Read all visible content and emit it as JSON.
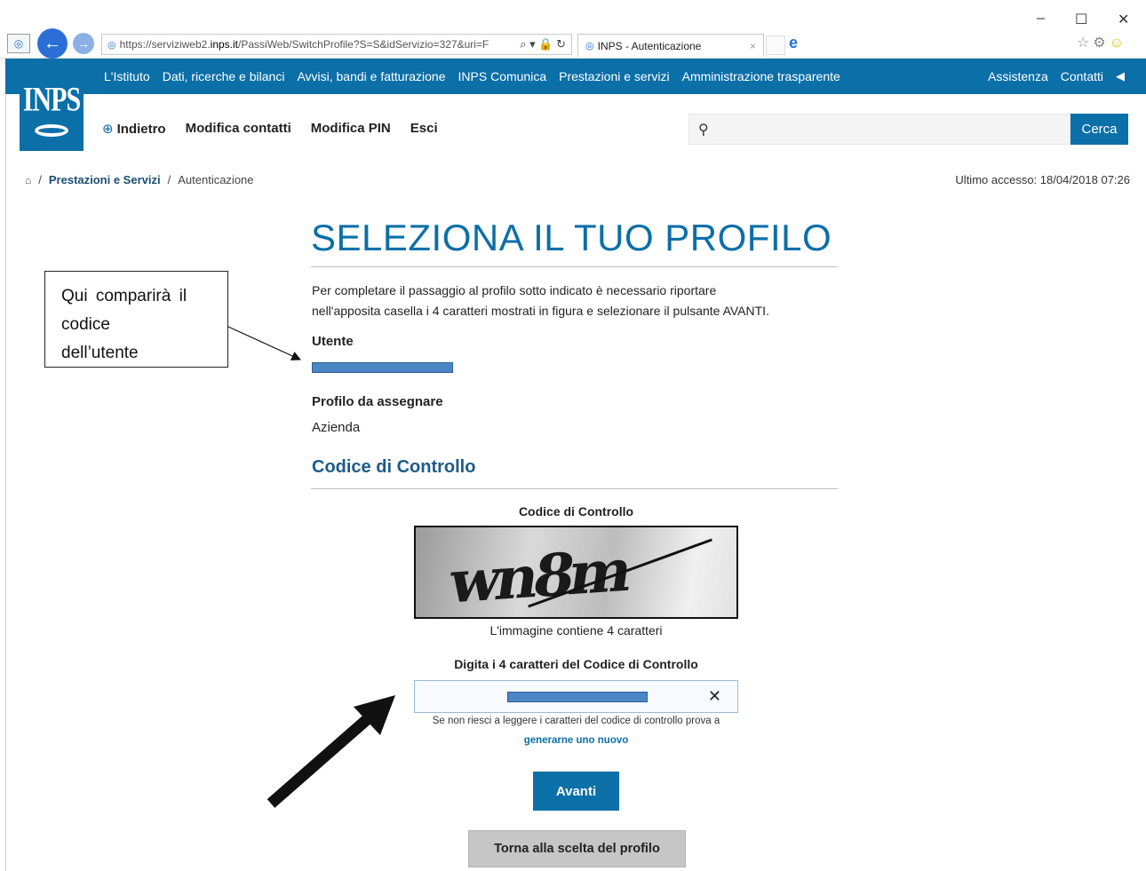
{
  "browser": {
    "url_prefix": "https://serviziweb2.",
    "url_domain": "inps.it",
    "url_rest": "/PassiWeb/SwitchProfile?S=S&idServizio=327&uri=F",
    "tab_title": "INPS - Autenticazione",
    "tab_close": "×",
    "window_controls": {
      "minimize": "–",
      "maximize": "☐",
      "close": "✕"
    }
  },
  "header": {
    "logo_text": "INPS",
    "top_links": [
      "L'Istituto",
      "Dati, ricerche e bilanci",
      "Avvisi, bandi e fatturazione",
      "INPS Comunica",
      "Prestazioni e servizi",
      "Amministrazione trasparente"
    ],
    "assistenza": "Assistenza",
    "contatti": "Contatti",
    "subnav": {
      "back": "Indietro",
      "modifica_contatti": "Modifica contatti",
      "modifica_pin": "Modifica PIN",
      "esci": "Esci"
    },
    "search": {
      "placeholder": "",
      "button": "Cerca"
    }
  },
  "breadcrumb": {
    "sep": "/",
    "item1": "Prestazioni e Servizi",
    "item2": "Autenticazione"
  },
  "last_access": "Ultimo accesso: 18/04/2018 07:26",
  "main": {
    "title": "SELEZIONA IL TUO PROFILO",
    "intro_line1": "Per completare il passaggio al profilo sotto indicato è necessario riportare",
    "intro_line2": "nell'apposita casella i 4 caratteri mostrati in figura e selezionare il pulsante AVANTI.",
    "utente_label": "Utente",
    "profilo_label": "Profilo da assegnare",
    "profilo_value": "Azienda",
    "section_title": "Codice di Controllo",
    "captcha_label": "Codice di Controllo",
    "captcha_text": "wn8m",
    "captcha_caption": "L'immagine contiene 4 caratteri",
    "code_label": "Digita i 4 caratteri del Codice di Controllo",
    "clear": "✕",
    "hint": "Se non riesci a leggere i caratteri del codice di controllo prova a",
    "regen_link": "generarne uno nuovo",
    "avanti": "Avanti",
    "torna": "Torna alla scelta del profilo"
  },
  "callout": {
    "line1": "Qui comparirà il",
    "line2": "codice",
    "line3": "dell’utente"
  },
  "colors": {
    "brand": "#0b6fa8",
    "masked_field": "#4a86c6"
  }
}
